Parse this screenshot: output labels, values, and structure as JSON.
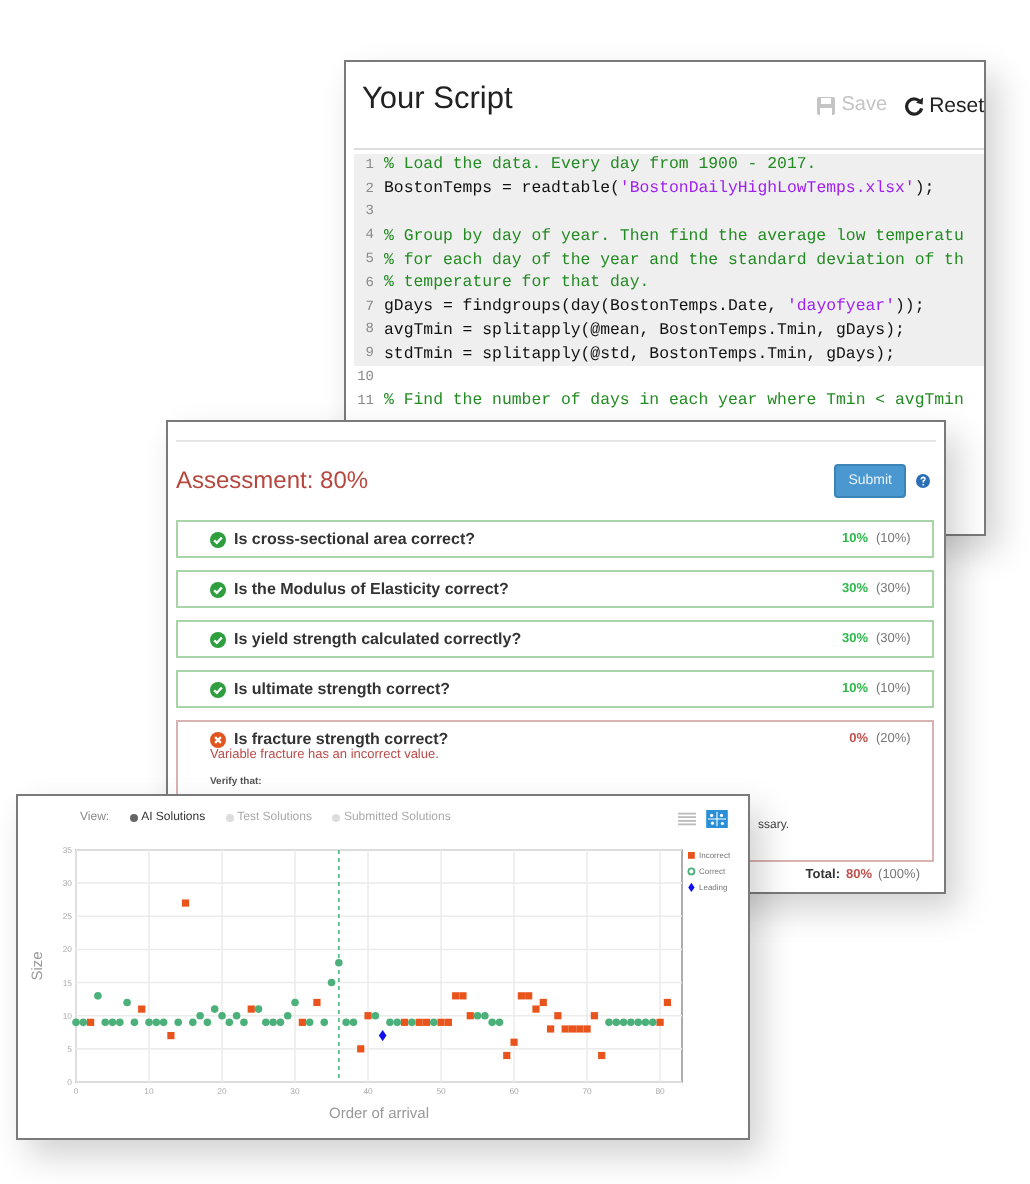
{
  "script_window": {
    "title": "Your Script",
    "save_button": {
      "label": "Save",
      "disabled": true
    },
    "reset_button": {
      "label": "Reset"
    },
    "code_lines": [
      {
        "number": "1",
        "highlighted": true,
        "tokens": [
          {
            "kind": "comment",
            "text": "% Load the data. Every day from 1900 - 2017."
          }
        ]
      },
      {
        "number": "2",
        "highlighted": true,
        "tokens": [
          {
            "kind": "code",
            "text": "BostonTemps = readtable("
          },
          {
            "kind": "string",
            "text": "'BostonDailyHighLowTemps.xlsx'"
          },
          {
            "kind": "code",
            "text": ");"
          }
        ]
      },
      {
        "number": "3",
        "highlighted": true
      },
      {
        "number": "4",
        "highlighted": true,
        "tokens": [
          {
            "kind": "comment",
            "text": "% Group by day of year. Then find the average low temperatu"
          }
        ]
      },
      {
        "number": "5",
        "highlighted": true,
        "tokens": [
          {
            "kind": "comment",
            "text": "% for each day of the year and the standard deviation of th"
          }
        ]
      },
      {
        "number": "6",
        "highlighted": true,
        "tokens": [
          {
            "kind": "comment",
            "text": "% temperature for that day."
          }
        ]
      },
      {
        "number": "7",
        "highlighted": true,
        "tokens": [
          {
            "kind": "code",
            "text": "gDays = findgroups(day(BostonTemps.Date, "
          },
          {
            "kind": "string",
            "text": "'dayofyear'"
          },
          {
            "kind": "code",
            "text": "));"
          }
        ]
      },
      {
        "number": "8",
        "highlighted": true,
        "tokens": [
          {
            "kind": "code",
            "text": "avgTmin = splitapply(@mean, BostonTemps.Tmin, gDays);"
          }
        ]
      },
      {
        "number": "9",
        "highlighted": true,
        "tokens": [
          {
            "kind": "code",
            "text": "stdTmin = splitapply(@std, BostonTemps.Tmin, gDays);"
          }
        ]
      },
      {
        "number": "10",
        "highlighted": false
      },
      {
        "number": "11",
        "highlighted": false,
        "tokens": [
          {
            "kind": "comment",
            "text": "% Find the number of days in each year where Tmin < avgTmin"
          }
        ]
      }
    ]
  },
  "assessment_window": {
    "title": "Assessment: 80%",
    "submit_button": "Submit",
    "checks": [
      {
        "passed": true,
        "label": "Is cross-sectional area correct?",
        "score": "10%",
        "weight": "(10%)"
      },
      {
        "passed": true,
        "label": "Is the Modulus of Elasticity correct?",
        "score": "30%",
        "weight": "(30%)"
      },
      {
        "passed": true,
        "label": "Is yield strength calculated correctly?",
        "score": "30%",
        "weight": "(30%)"
      },
      {
        "passed": true,
        "label": "Is ultimate strength correct?",
        "score": "10%",
        "weight": "(10%)"
      },
      {
        "passed": false,
        "label": "Is fracture strength correct?",
        "score": "0%",
        "weight": "(20%)",
        "message": "Variable fracture has an incorrect value.",
        "detail": "Verify that:",
        "detail_tail": "ssary."
      }
    ],
    "total_label": "Total:",
    "total_score": "80%",
    "total_weight": "(100%)"
  },
  "chart_window": {
    "view_label": "View:",
    "view_options": [
      {
        "label": "AI Solutions",
        "selected": true
      },
      {
        "label": "Test Solutions",
        "selected": false
      },
      {
        "label": "Submitted Solutions",
        "selected": false
      }
    ],
    "view_toggles": [
      {
        "kind": "list",
        "selected": false
      },
      {
        "kind": "scatter",
        "selected": true
      }
    ],
    "chart_data": {
      "type": "scatter",
      "xlabel": "Order of arrival",
      "ylabel": "Size",
      "x": [
        0,
        1,
        2,
        3,
        4,
        5,
        6,
        7,
        8,
        9,
        10,
        11,
        12,
        13,
        14,
        15,
        16,
        17,
        18,
        19,
        20,
        21,
        22,
        23,
        24,
        25,
        26,
        27,
        28,
        29,
        30,
        31,
        32,
        33,
        34,
        35,
        36,
        37,
        38,
        39,
        40,
        41,
        42,
        43,
        44,
        45,
        46,
        47,
        48,
        49,
        50,
        51,
        52,
        53,
        54,
        55,
        56,
        57,
        58,
        59,
        60,
        61,
        62,
        63,
        64,
        65,
        66,
        67,
        68,
        69,
        70,
        71,
        72,
        73,
        74,
        75,
        76,
        77,
        78,
        79,
        80,
        81
      ],
      "series": [
        {
          "name": "Incorrect",
          "color": "#e8541b",
          "marker": "square",
          "values": [
            null,
            null,
            9,
            null,
            null,
            null,
            null,
            null,
            null,
            11,
            null,
            null,
            null,
            7,
            null,
            27,
            null,
            null,
            null,
            null,
            null,
            null,
            null,
            null,
            11,
            null,
            null,
            null,
            null,
            null,
            null,
            9,
            null,
            12,
            null,
            null,
            null,
            null,
            null,
            5,
            10,
            null,
            null,
            null,
            null,
            9,
            null,
            9,
            9,
            null,
            9,
            9,
            13,
            13,
            10,
            null,
            null,
            null,
            null,
            4,
            6,
            13,
            13,
            11,
            12,
            8,
            10,
            8,
            8,
            8,
            8,
            10,
            4,
            null,
            null,
            null,
            null,
            null,
            null,
            null,
            9,
            12
          ]
        },
        {
          "name": "Correct",
          "color": "#4cb07a",
          "marker": "circle",
          "values": [
            9,
            9,
            null,
            13,
            9,
            9,
            9,
            12,
            9,
            null,
            9,
            9,
            9,
            null,
            9,
            null,
            9,
            10,
            9,
            11,
            10,
            9,
            10,
            9,
            null,
            11,
            9,
            9,
            9,
            10,
            12,
            null,
            9,
            null,
            9,
            15,
            18,
            9,
            9,
            null,
            null,
            10,
            null,
            9,
            9,
            null,
            9,
            null,
            null,
            9,
            null,
            null,
            null,
            null,
            null,
            10,
            10,
            9,
            9,
            null,
            null,
            null,
            null,
            null,
            null,
            null,
            null,
            null,
            null,
            null,
            null,
            null,
            null,
            9,
            9,
            9,
            9,
            9,
            9,
            9,
            null,
            null
          ]
        },
        {
          "name": "Leading",
          "color": "#1010ee",
          "marker": "diamond",
          "values": [
            null,
            null,
            null,
            null,
            null,
            null,
            null,
            null,
            null,
            null,
            null,
            null,
            null,
            null,
            null,
            null,
            null,
            null,
            null,
            null,
            null,
            null,
            null,
            null,
            null,
            null,
            null,
            null,
            null,
            null,
            null,
            null,
            null,
            null,
            null,
            null,
            null,
            null,
            null,
            null,
            null,
            null,
            7,
            null,
            null,
            null,
            null,
            null,
            null,
            null,
            null,
            null,
            null,
            null,
            null,
            null,
            null,
            null,
            null,
            null,
            null,
            null,
            null,
            null,
            null,
            null,
            null,
            null,
            null,
            null,
            null,
            null,
            null,
            null,
            null,
            null,
            null,
            null,
            null,
            null,
            null,
            null
          ]
        }
      ],
      "xlim": [
        0,
        83
      ],
      "ylim": [
        0,
        35
      ],
      "xticks": [
        0,
        10,
        20,
        30,
        40,
        50,
        60,
        70,
        80
      ],
      "yticks": [
        0,
        5,
        10,
        15,
        20,
        25,
        30,
        35
      ],
      "grid": true,
      "legend": true,
      "ref_lines": [
        {
          "axis": "x",
          "value": 36,
          "color": "#5bbf85"
        }
      ]
    }
  }
}
